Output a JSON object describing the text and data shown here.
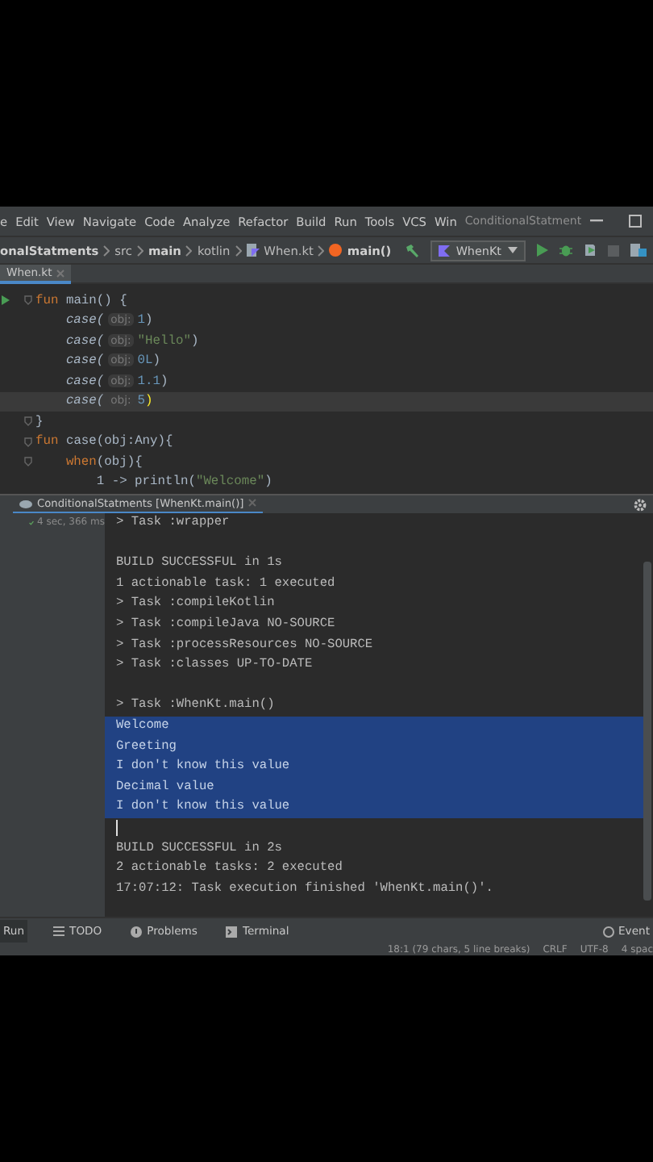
{
  "menu": [
    "e",
    "Edit",
    "View",
    "Navigate",
    "Code",
    "Analyze",
    "Refactor",
    "Build",
    "Run",
    "Tools",
    "VCS",
    "Win"
  ],
  "window_title": "ConditionalStatment",
  "breadcrumbs": [
    {
      "text": "onalStatments",
      "kind": "project"
    },
    {
      "text": "src",
      "kind": "folder"
    },
    {
      "text": "main",
      "kind": "folder"
    },
    {
      "text": "kotlin",
      "kind": "folder"
    },
    {
      "text": "When.kt",
      "kind": "file"
    },
    {
      "text": "main()",
      "kind": "function"
    }
  ],
  "run_config": "WhenKt",
  "editor_tabs": [
    {
      "label": "When.kt",
      "selected": true
    }
  ],
  "code_lines": [
    {
      "run": true,
      "fold": true,
      "current": false,
      "segments": [
        {
          "text": "fun",
          "kind": "keyword"
        },
        {
          "text": " main() {",
          "kind": "plain"
        }
      ]
    },
    {
      "run": false,
      "fold": false,
      "current": false,
      "segments": [
        {
          "text": "    case(",
          "kind": "call"
        },
        {
          "text": "obj:",
          "kind": "hint"
        },
        {
          "text": "1",
          "kind": "number"
        },
        {
          "text": ")",
          "kind": "plain"
        }
      ]
    },
    {
      "run": false,
      "fold": false,
      "current": false,
      "segments": [
        {
          "text": "    case(",
          "kind": "call"
        },
        {
          "text": "obj:",
          "kind": "hint"
        },
        {
          "text": "\"Hello\"",
          "kind": "string"
        },
        {
          "text": ")",
          "kind": "plain"
        }
      ]
    },
    {
      "run": false,
      "fold": false,
      "current": false,
      "segments": [
        {
          "text": "    case(",
          "kind": "call"
        },
        {
          "text": "obj:",
          "kind": "hint"
        },
        {
          "text": "0L",
          "kind": "number"
        },
        {
          "text": ")",
          "kind": "plain"
        }
      ]
    },
    {
      "run": false,
      "fold": false,
      "current": false,
      "segments": [
        {
          "text": "    case(",
          "kind": "call"
        },
        {
          "text": "obj:",
          "kind": "hint"
        },
        {
          "text": "1.1",
          "kind": "number"
        },
        {
          "text": ")",
          "kind": "plain"
        }
      ]
    },
    {
      "run": false,
      "fold": false,
      "current": true,
      "segments": [
        {
          "text": "    case(",
          "kind": "call"
        },
        {
          "text": "obj:",
          "kind": "hint"
        },
        {
          "text": "5",
          "kind": "number"
        },
        {
          "text": ")",
          "kind": "paren"
        }
      ]
    },
    {
      "run": false,
      "fold": true,
      "current": false,
      "segments": [
        {
          "text": "}",
          "kind": "plain"
        }
      ]
    },
    {
      "run": false,
      "fold": true,
      "current": false,
      "segments": [
        {
          "text": "fun",
          "kind": "keyword"
        },
        {
          "text": " case(obj:Any){",
          "kind": "plain"
        }
      ]
    },
    {
      "run": false,
      "fold": true,
      "current": false,
      "segments": [
        {
          "text": "    when",
          "kind": "keyword"
        },
        {
          "text": "(obj){",
          "kind": "plain"
        }
      ]
    },
    {
      "run": false,
      "fold": false,
      "current": false,
      "segments": [
        {
          "text": "        1 -> println(",
          "kind": "plain"
        },
        {
          "text": "\"Welcome\"",
          "kind": "string"
        },
        {
          "text": ")",
          "kind": "plain"
        }
      ]
    }
  ],
  "run_panel": {
    "tab": {
      "label": "ConditionalStatments [WhenKt.main()]",
      "selected": true
    },
    "duration": "4 sec, 366 ms",
    "console": [
      {
        "kind": "text",
        "text": "> Task :wrapper",
        "selected": false
      },
      {
        "kind": "blank"
      },
      {
        "kind": "text",
        "text": "BUILD SUCCESSFUL in 1s",
        "selected": false
      },
      {
        "kind": "text",
        "text": "1 actionable task: 1 executed",
        "selected": false
      },
      {
        "kind": "text",
        "text": "> Task :compileKotlin",
        "selected": false
      },
      {
        "kind": "text",
        "text": "> Task :compileJava NO-SOURCE",
        "selected": false
      },
      {
        "kind": "text",
        "text": "> Task :processResources NO-SOURCE",
        "selected": false
      },
      {
        "kind": "text",
        "text": "> Task :classes UP-TO-DATE",
        "selected": false
      },
      {
        "kind": "blank"
      },
      {
        "kind": "text",
        "text": "> Task :WhenKt.main()",
        "selected": false
      },
      {
        "kind": "text",
        "text": "Welcome",
        "selected": true
      },
      {
        "kind": "text",
        "text": "Greeting",
        "selected": true
      },
      {
        "kind": "text",
        "text": "I don't know this value",
        "selected": true
      },
      {
        "kind": "text",
        "text": "Decimal value",
        "selected": true
      },
      {
        "kind": "text",
        "text": "I don't know this value",
        "selected": true
      },
      {
        "kind": "cursor"
      },
      {
        "kind": "text",
        "text": "BUILD SUCCESSFUL in 2s",
        "selected": false
      },
      {
        "kind": "text",
        "text": "2 actionable tasks: 2 executed",
        "selected": false
      },
      {
        "kind": "text",
        "text": "17:07:12: Task execution finished 'WhenKt.main()'.",
        "selected": false
      }
    ]
  },
  "tool_windows": [
    {
      "label": "Run",
      "kind": "run",
      "selected": true
    },
    {
      "label": "TODO",
      "kind": "list",
      "selected": false
    },
    {
      "label": "Problems",
      "kind": "problems",
      "selected": false
    },
    {
      "label": "Terminal",
      "kind": "terminal",
      "selected": false
    }
  ],
  "event_log": "Event",
  "status": [
    "18:1 (79 chars, 5 line breaks)",
    "CRLF",
    "UTF-8",
    "4 spac"
  ]
}
